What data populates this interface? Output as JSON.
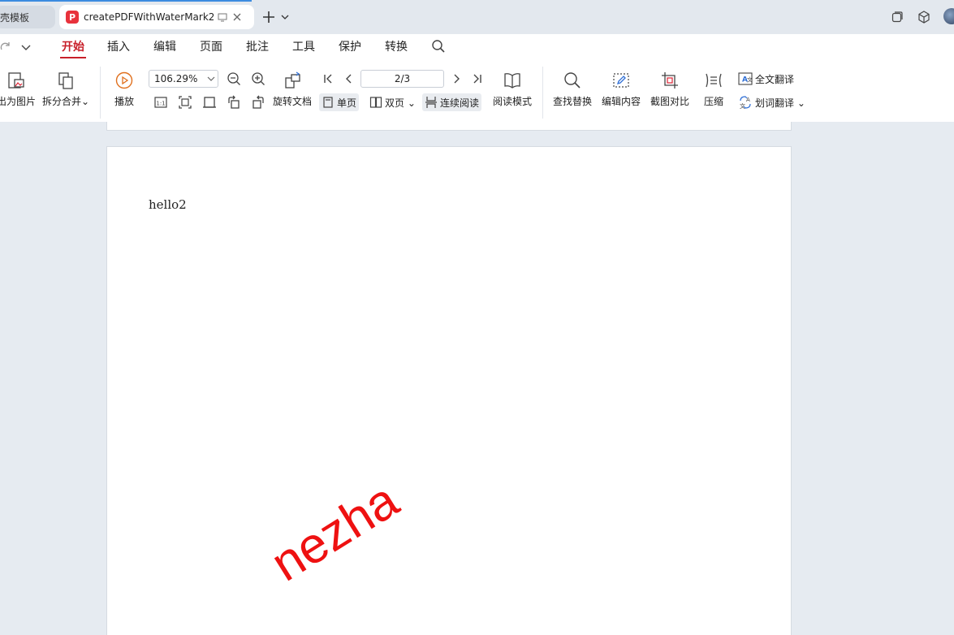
{
  "tabs": {
    "inactive_label": "壳模板",
    "active_title": "createPDFWithWaterMark2.",
    "pdf_logo": "P"
  },
  "menu": {
    "items": [
      "开始",
      "插入",
      "编辑",
      "页面",
      "批注",
      "工具",
      "保护",
      "转换"
    ],
    "active_index": 0,
    "accent_color": "#c8202a"
  },
  "ribbon": {
    "to_image_label": "出为图片",
    "split_merge_label": "拆分合并",
    "play_label": "播放",
    "zoom_value": "106.29%",
    "page_value": "2/3",
    "rotate_label": "旋转文档",
    "single_page_label": "单页",
    "double_page_label": "双页",
    "continuous_label": "连续阅读",
    "read_mode_label": "阅读模式",
    "find_replace_label": "查找替换",
    "edit_content_label": "编辑内容",
    "screenshot_compare_label": "截图对比",
    "compress_label": "压缩",
    "full_translate_label": "全文翻译",
    "word_translate_label": "划词翻译"
  },
  "document": {
    "page_text": "hello2",
    "watermark_text": "nezha",
    "watermark_color": "#ee1111"
  }
}
